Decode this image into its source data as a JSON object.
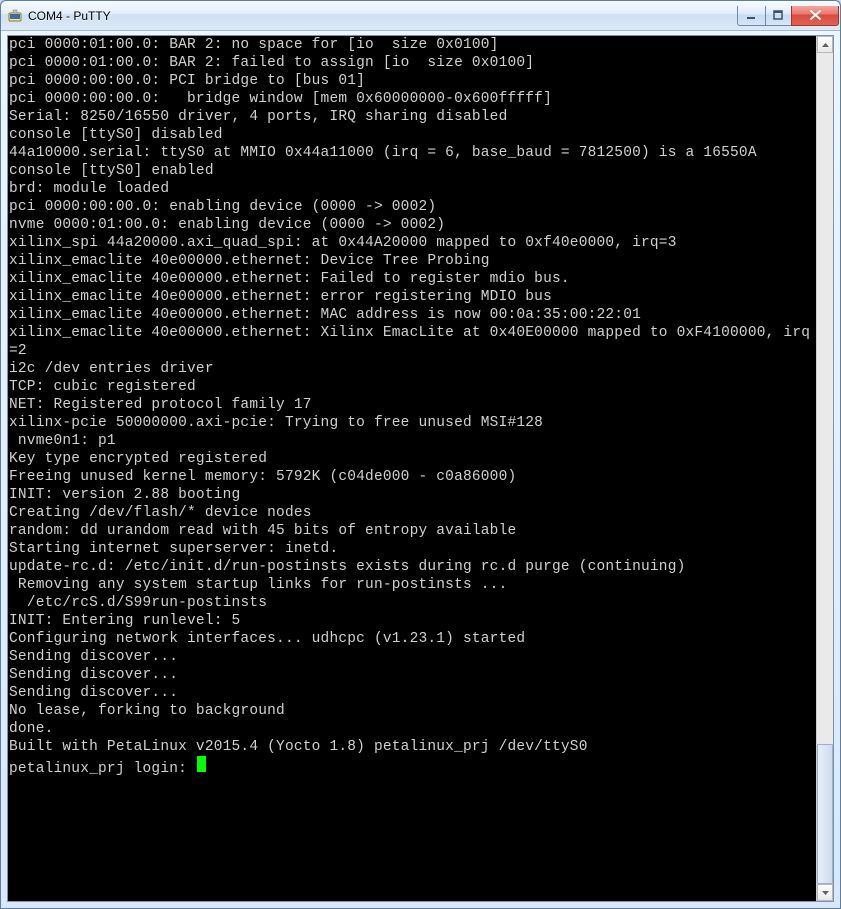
{
  "window": {
    "title": "COM4 - PuTTY"
  },
  "terminal": {
    "lines": [
      "pci 0000:01:00.0: BAR 2: no space for [io  size 0x0100]",
      "pci 0000:01:00.0: BAR 2: failed to assign [io  size 0x0100]",
      "pci 0000:00:00.0: PCI bridge to [bus 01]",
      "pci 0000:00:00.0:   bridge window [mem 0x60000000-0x600fffff]",
      "Serial: 8250/16550 driver, 4 ports, IRQ sharing disabled",
      "console [ttyS0] disabled",
      "44a10000.serial: ttyS0 at MMIO 0x44a11000 (irq = 6, base_baud = 7812500) is a 16550A",
      "console [ttyS0] enabled",
      "brd: module loaded",
      "pci 0000:00:00.0: enabling device (0000 -> 0002)",
      "nvme 0000:01:00.0: enabling device (0000 -> 0002)",
      "xilinx_spi 44a20000.axi_quad_spi: at 0x44A20000 mapped to 0xf40e0000, irq=3",
      "xilinx_emaclite 40e00000.ethernet: Device Tree Probing",
      "xilinx_emaclite 40e00000.ethernet: Failed to register mdio bus.",
      "xilinx_emaclite 40e00000.ethernet: error registering MDIO bus",
      "xilinx_emaclite 40e00000.ethernet: MAC address is now 00:0a:35:00:22:01",
      "xilinx_emaclite 40e00000.ethernet: Xilinx EmacLite at 0x40E00000 mapped to 0xF4100000, irq=2",
      "i2c /dev entries driver",
      "TCP: cubic registered",
      "NET: Registered protocol family 17",
      "xilinx-pcie 50000000.axi-pcie: Trying to free unused MSI#128",
      " nvme0n1: p1",
      "Key type encrypted registered",
      "Freeing unused kernel memory: 5792K (c04de000 - c0a86000)",
      "INIT: version 2.88 booting",
      "Creating /dev/flash/* device nodes",
      "random: dd urandom read with 45 bits of entropy available",
      "Starting internet superserver: inetd.",
      "update-rc.d: /etc/init.d/run-postinsts exists during rc.d purge (continuing)",
      " Removing any system startup links for run-postinsts ...",
      "  /etc/rcS.d/S99run-postinsts",
      "INIT: Entering runlevel: 5",
      "Configuring network interfaces... udhcpc (v1.23.1) started",
      "Sending discover...",
      "Sending discover...",
      "Sending discover...",
      "No lease, forking to background",
      "done.",
      "",
      "Built with PetaLinux v2015.4 (Yocto 1.8) petalinux_prj /dev/ttyS0"
    ],
    "prompt": "petalinux_prj login: "
  }
}
